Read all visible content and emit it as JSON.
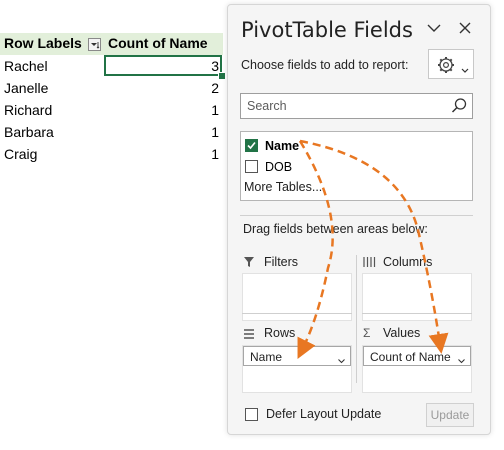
{
  "pivot": {
    "header": {
      "row_labels": "Row Labels",
      "count_of_name": "Count of Name"
    },
    "rows": [
      {
        "label": "Rachel",
        "count": "3"
      },
      {
        "label": "Janelle",
        "count": "2"
      },
      {
        "label": "Richard",
        "count": "1"
      },
      {
        "label": "Barbara",
        "count": "1"
      },
      {
        "label": "Craig",
        "count": "1"
      }
    ]
  },
  "pane": {
    "title": "PivotTable Fields",
    "choose_label": "Choose fields to add to report:",
    "search_placeholder": "Search",
    "fields": [
      {
        "label": "Name",
        "checked": true
      },
      {
        "label": "DOB",
        "checked": false
      }
    ],
    "more_tables": "More Tables...",
    "drag_label": "Drag fields between areas below:",
    "areas": {
      "filters": "Filters",
      "columns": "Columns",
      "rows": "Rows",
      "values": "Values"
    },
    "rows_chip": "Name",
    "values_chip": "Count of Name",
    "defer_label": "Defer Layout Update",
    "update_label": "Update"
  },
  "colors": {
    "excel_green": "#217346",
    "header_fill": "#e2efda",
    "arrow_orange": "#e87722"
  }
}
